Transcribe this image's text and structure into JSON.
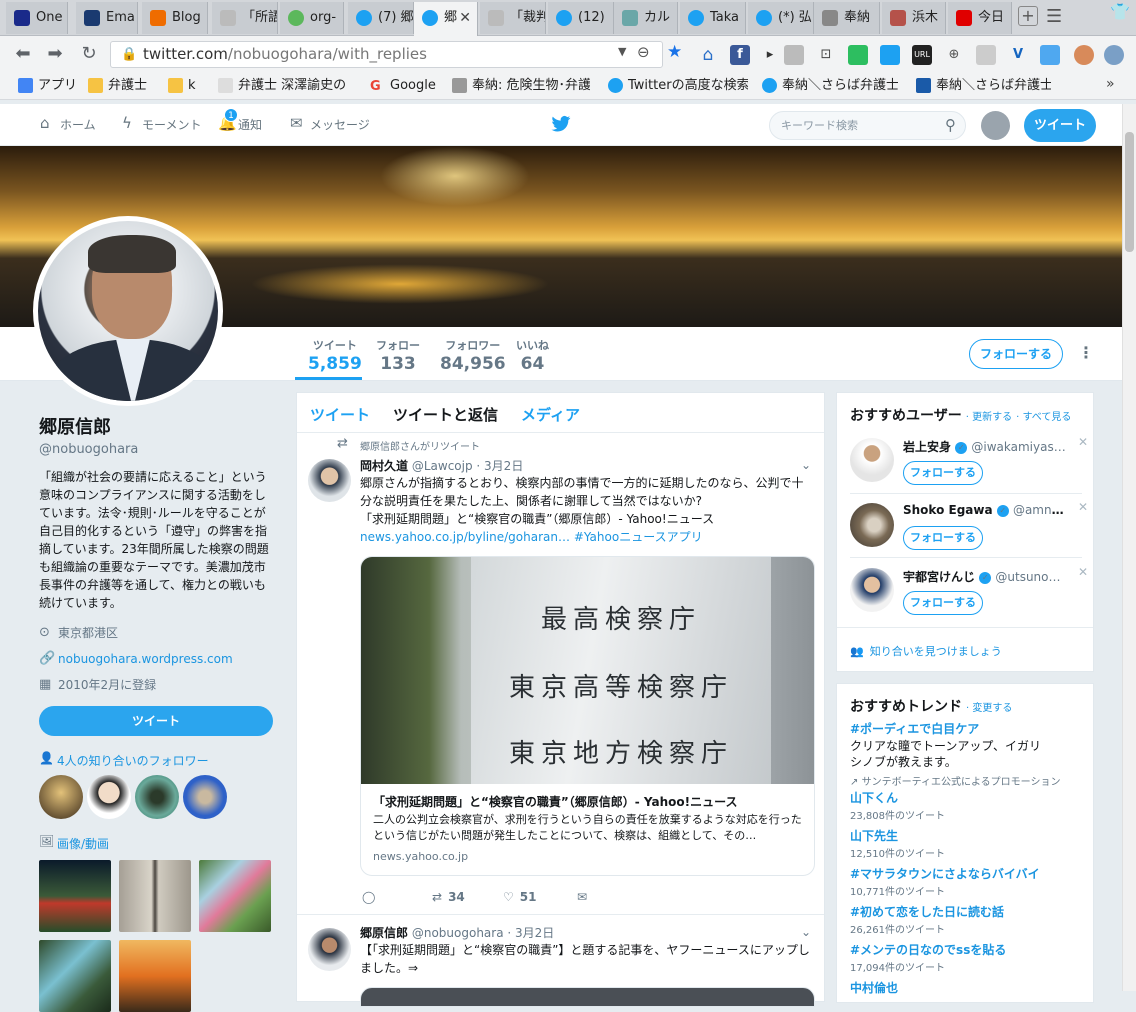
{
  "browser": {
    "tabs": [
      {
        "label": "One",
        "color": "#1a2a8a"
      },
      {
        "label": "Ema",
        "color": "#1a3a70"
      },
      {
        "label": "Blog",
        "color": "#ef6c00"
      },
      {
        "label": "「所語",
        "color": "#9e9e9e"
      },
      {
        "label": "org-",
        "color": "#5cb85c"
      },
      {
        "label": "(7) 郷",
        "color": "#1da1f2"
      },
      {
        "label": "郷",
        "color": "#1da1f2"
      },
      {
        "label": "「裁判",
        "color": "#9e9e9e"
      },
      {
        "label": "(12)",
        "color": "#1da1f2"
      },
      {
        "label": "カル",
        "color": "#6aa7a8"
      },
      {
        "label": "Taka",
        "color": "#1da1f2"
      },
      {
        "label": "(*) 弘",
        "color": "#1da1f2"
      },
      {
        "label": "奉納",
        "color": "#888888"
      },
      {
        "label": "浜木",
        "color": "#b5524a"
      },
      {
        "label": "今日",
        "color": "#e00000"
      }
    ],
    "url_host": "twitter.com",
    "url_path": "/nobuogohara/with_replies",
    "bookmarks": [
      {
        "label": "アプリ",
        "color": "#4285f4"
      },
      {
        "label": "弁護士",
        "color": "#f6c343"
      },
      {
        "label": "k",
        "color": "#f6c343"
      },
      {
        "label": "弁護士 深澤諭史の",
        "color": "#c9c9c9"
      },
      {
        "label": "Google",
        "color": "#ea4335"
      },
      {
        "label": "奉納: 危険生物･弁護",
        "color": "#999999"
      },
      {
        "label": "Twitterの高度な検索",
        "color": "#1da1f2"
      },
      {
        "label": "奉納＼さらば弁護士",
        "color": "#1da1f2"
      },
      {
        "label": "奉納＼さらば弁護士",
        "color": "#1da1f2"
      }
    ]
  },
  "twitter_nav": {
    "home": "ホーム",
    "moments": "モーメント",
    "notifications": "通知",
    "notif_count": "1",
    "messages": "メッセージ",
    "search_placeholder": "キーワード検索",
    "tweet_button": "ツイート"
  },
  "profile": {
    "stats": [
      {
        "label": "ツイート",
        "value": "5,859"
      },
      {
        "label": "フォロー",
        "value": "133"
      },
      {
        "label": "フォロワー",
        "value": "84,956"
      },
      {
        "label": "いいね",
        "value": "64"
      }
    ],
    "follow_button": "フォローする",
    "name": "郷原信郎",
    "handle": "@nobuogohara",
    "bio": "「組織が社会の要請に応えること」という意味のコンプライアンスに関する活動をしています。法令･規則･ルールを守ることが自己目的化するという「遵守」の弊害を指摘しています。23年間所属した検察の問題も組織論の重要なテーマです。美濃加茂市長事件の弁護等を通して、権力との戦いも続けています。",
    "location": "東京都港区",
    "website": "nobuogohara.wordpress.com",
    "joined": "2010年2月に登録",
    "tweet_button": "ツイート",
    "known_followers": "4人の知り合いのフォロワー",
    "media_heading": "画像/動画"
  },
  "timeline": {
    "tabs": [
      "ツイート",
      "ツイートと返信",
      "メディア"
    ],
    "retweet_note": "郷原信郎さんがリツイート",
    "tweet1": {
      "name": "岡村久道",
      "handle": "@Lawcojp",
      "date": "· 3月2日",
      "text": "郷原さんが指摘するとおり、検察内部の事情で一方的に延期したのなら、公判で十分な説明責任を果たした上、関係者に謝罪して当然ではないか?",
      "quote": "「求刑延期問題」と“検察官の職責”（郷原信郎）- Yahoo!ニュース",
      "link": "news.yahoo.co.jp/byline/goharan…",
      "hashtag": "#Yahooニュースアプリ",
      "card_lines": [
        "最高検察庁",
        "東京高等検察庁",
        "東京地方検察庁"
      ],
      "card_title": "「求刑延期問題」と“検察官の職責”（郷原信郎）- Yahoo!ニュース",
      "card_desc": "二人の公判立会検察官が、求刑を行うという自らの責任を放棄するような対応を行ったという信じがたい問題が発生したことについて、検察は、組織として、その…",
      "card_domain": "news.yahoo.co.jp",
      "retweets": "34",
      "likes": "51"
    },
    "tweet2": {
      "name": "郷原信郎",
      "handle": "@nobuogohara",
      "date": "· 3月2日",
      "text": "【「求刑延期問題」と“検察官の職責”】と題する記事を、ヤフーニュースにアップしました。⇒"
    }
  },
  "suggestions": {
    "title": "おすすめユーザー",
    "refresh": "· 更新する",
    "see_all": "· すべて見る",
    "users": [
      {
        "name": "岩上安身",
        "handle": "@iwakamiyas…",
        "follow": "フォローする"
      },
      {
        "name": "Shoko Egawa",
        "handle": "@amner…",
        "follow": "フォローする"
      },
      {
        "name": "宇都宮けんじ",
        "handle": "@utsuno…",
        "follow": "フォローする"
      }
    ],
    "find_friends": "知り合いを見つけましょう"
  },
  "trends": {
    "title": "おすすめトレンド",
    "change": "· 変更する",
    "promoted": {
      "name": "#ポーディエで白目ケア",
      "desc": "クリアな瞳でトーンアップ、イガリシノブが教えます。",
      "by": "サンテボーティエ公式によるプロモーション"
    },
    "items": [
      {
        "name": "山下くん",
        "count": "23,808件のツイート"
      },
      {
        "name": "山下先生",
        "count": "12,510件のツイート"
      },
      {
        "name": "#マサラタウンにさよならバイバイ",
        "count": "10,771件のツイート"
      },
      {
        "name": "#初めて恋をした日に読む話",
        "count": "26,261件のツイート"
      },
      {
        "name": "#メンテの日なのでssを貼る",
        "count": "17,094件のツイート"
      },
      {
        "name": "中村倫也",
        "count": ""
      }
    ]
  }
}
